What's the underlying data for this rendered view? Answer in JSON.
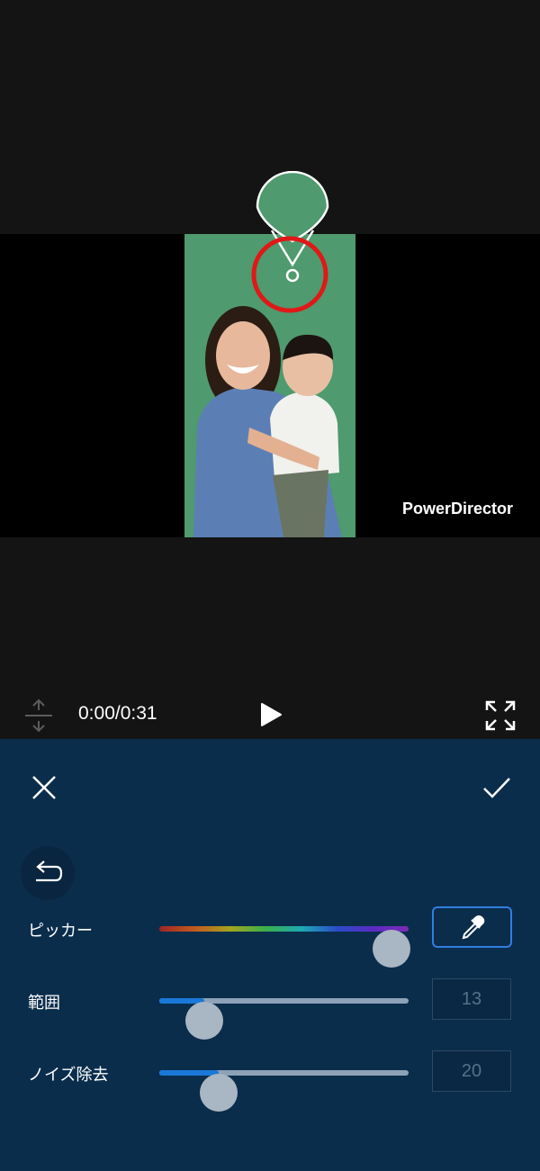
{
  "video": {
    "watermark": "PowerDirector",
    "background_color": "#4f9a6e"
  },
  "controls": {
    "timecode": "0:00/0:31"
  },
  "panel": {
    "background_color": "#0b2d4c",
    "picker": {
      "label": "ピッカー",
      "value_fraction": 0.93
    },
    "range": {
      "label": "範囲",
      "value": "13",
      "value_fraction": 0.18
    },
    "noise": {
      "label": "ノイズ除去",
      "value": "20",
      "value_fraction": 0.24
    }
  },
  "icons": {
    "split": "split-vertical-icon",
    "play": "play-icon",
    "fullscreen": "fullscreen-icon",
    "close": "close-icon",
    "confirm": "check-icon",
    "back": "undo-icon",
    "eyedropper": "eyedropper-icon"
  }
}
